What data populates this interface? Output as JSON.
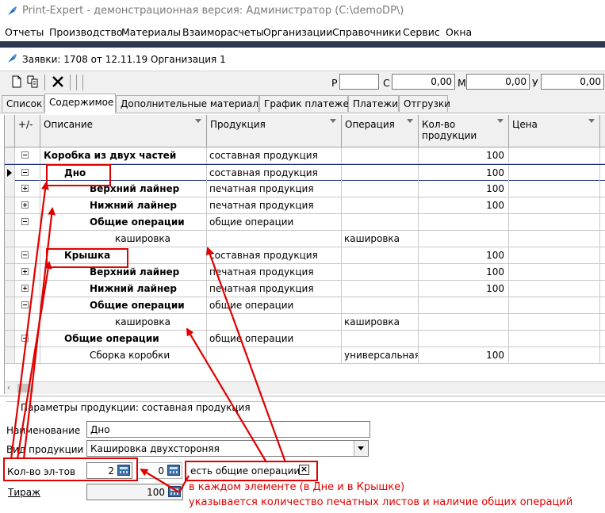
{
  "window": {
    "title": "Print-Expert - демонстрационная версия: Администратор (C:\\demoDP\\)"
  },
  "menu": [
    "Отчеты",
    "Производство",
    "Материалы",
    "Взаиморасчеты",
    "Организации",
    "Справочники",
    "Сервис",
    "Окна"
  ],
  "document": {
    "header": "Заявки: 1708 от 12.11.19  Организация 1"
  },
  "toolbar": {
    "r_label": "Р",
    "r_value": "",
    "s_label": "С",
    "s_value": "0,00",
    "m_label": "М",
    "m_value": "0,00",
    "u_label": "У",
    "u_value": "0,00"
  },
  "tabs": [
    {
      "label": "Список",
      "active": false
    },
    {
      "label": "Содержимое",
      "active": true
    },
    {
      "label": "Дополнительные материалы",
      "active": false
    },
    {
      "label": "График платежей",
      "active": false
    },
    {
      "label": "Платежи",
      "active": false
    },
    {
      "label": "Отгрузки",
      "active": false
    }
  ],
  "grid": {
    "columns": {
      "toggle": "+/-",
      "description": "Описание",
      "product": "Продукция",
      "operation": "Операция",
      "qty": "Кол-во продукции",
      "price": "Цена"
    },
    "rows": [
      {
        "toggle": "minus",
        "description": "Коробка из двух частей",
        "bold": true,
        "level": 0,
        "product": "составная продукция",
        "operation": "",
        "qty": "100",
        "current": false
      },
      {
        "toggle": "minus",
        "description": "Дно",
        "bold": true,
        "level": 1,
        "product": "составная продукция",
        "operation": "",
        "qty": "100",
        "current": true
      },
      {
        "toggle": "plus",
        "description": "Верхний лайнер",
        "bold": true,
        "level": 2,
        "product": "печатная продукция",
        "operation": "",
        "qty": "100",
        "current": false
      },
      {
        "toggle": "plus",
        "description": "Нижний лайнер",
        "bold": true,
        "level": 2,
        "product": "печатная продукция",
        "operation": "",
        "qty": "100",
        "current": false
      },
      {
        "toggle": "minus",
        "description": "Общие операции",
        "bold": true,
        "level": 2,
        "product": "общие операции",
        "operation": "",
        "qty": "",
        "current": false
      },
      {
        "toggle": "",
        "description": "кашировка",
        "bold": false,
        "level": 3,
        "product": "",
        "operation": "кашировка",
        "qty": "",
        "current": false
      },
      {
        "toggle": "minus",
        "description": "Крышка",
        "bold": true,
        "level": 1,
        "product": "составная продукция",
        "operation": "",
        "qty": "100",
        "current": false
      },
      {
        "toggle": "plus",
        "description": "Верхний лайнер",
        "bold": true,
        "level": 2,
        "product": "печатная продукция",
        "operation": "",
        "qty": "100",
        "current": false
      },
      {
        "toggle": "plus",
        "description": "Нижний лайнер",
        "bold": true,
        "level": 2,
        "product": "печатная продукция",
        "operation": "",
        "qty": "100",
        "current": false
      },
      {
        "toggle": "minus",
        "description": "Общие операции",
        "bold": true,
        "level": 2,
        "product": "общие операции",
        "operation": "",
        "qty": "",
        "current": false
      },
      {
        "toggle": "",
        "description": "кашировка",
        "bold": false,
        "level": 3,
        "product": "",
        "operation": "кашировка",
        "qty": "",
        "current": false
      },
      {
        "toggle": "minus",
        "description": "Общие операции",
        "bold": true,
        "level": 1,
        "product": "общие операции",
        "operation": "",
        "qty": "",
        "current": false
      },
      {
        "toggle": "",
        "description": "Сборка коробки",
        "bold": false,
        "level": 2,
        "product": "",
        "operation": "универсальная",
        "qty": "100",
        "current": false
      }
    ]
  },
  "params": {
    "group_title": "Параметры продукции: составная продукция",
    "name_label": "Наименование",
    "name_value": "Дно",
    "kind_label": "Вид продукции",
    "kind_value": "Кашировка двухстороняя",
    "count_label": "Кол-во эл-тов",
    "count_value": "2",
    "count2_value": "0",
    "common_ops_label": "есть общие операции",
    "common_ops_checked": true,
    "tirazh_label": "Тираж",
    "tirazh_value": "100"
  },
  "annotation": {
    "line1": "в каждом элементе (в Дне и в Крышке)",
    "line2": "указывается количество печатных листов и наличие общих операций",
    "color": "#e00000"
  }
}
